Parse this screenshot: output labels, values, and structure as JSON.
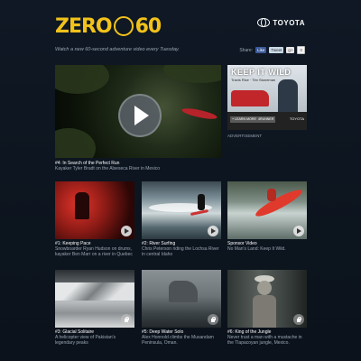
{
  "header": {
    "logo_left": "ZERO",
    "logo_right": "60",
    "sponsor": "TOYOTA",
    "tagline": "Watch a new 60-second adventure video every Tuesday."
  },
  "share": {
    "label": "Share:",
    "like": "Like",
    "tweet": "Tweet",
    "gplus": "g+",
    "count": "0"
  },
  "featured": {
    "title": "#4: In Search of the Perfect Run",
    "description": "Kayaker Tyler Bradt on the Alseseca River in Mexico"
  },
  "ad": {
    "title": "KEEP IT WILD",
    "subtitle": "Travis Rice · Tim Stoneman",
    "button1": "+ LEARN MORE",
    "button2": "4RUNNER",
    "brand": "TOYOTA",
    "label": "ADVERTISEMENT"
  },
  "videos": [
    {
      "title": "#1: Keeping Pace",
      "description": "Snowboarder Ryan Hudson on drums, kayaker Ben Marr on a river in Quebec",
      "status": "play"
    },
    {
      "title": "#2: River Surfing",
      "description": "Chris Peterson riding the Lochsa River in central Idaho",
      "status": "play"
    },
    {
      "title": "Sponsor Video",
      "description": "No Man's Land: Keep It Wild.",
      "status": "play"
    },
    {
      "title": "#3: Glacial Solitaire",
      "description": "A helicopter view of Pakistan's legendary peaks",
      "status": "locked"
    },
    {
      "title": "#5: Deep Water Solo",
      "description": "Alex Honnold climbs the Musandam Peninsula, Oman.",
      "status": "locked"
    },
    {
      "title": "#6: King of the Jungle",
      "description": "Never trust a man with a mustache in the Tlapacoyan jungle, Mexico.",
      "status": "locked"
    }
  ],
  "colors": {
    "accent": "#f2c21b",
    "background": "#0d1520"
  }
}
